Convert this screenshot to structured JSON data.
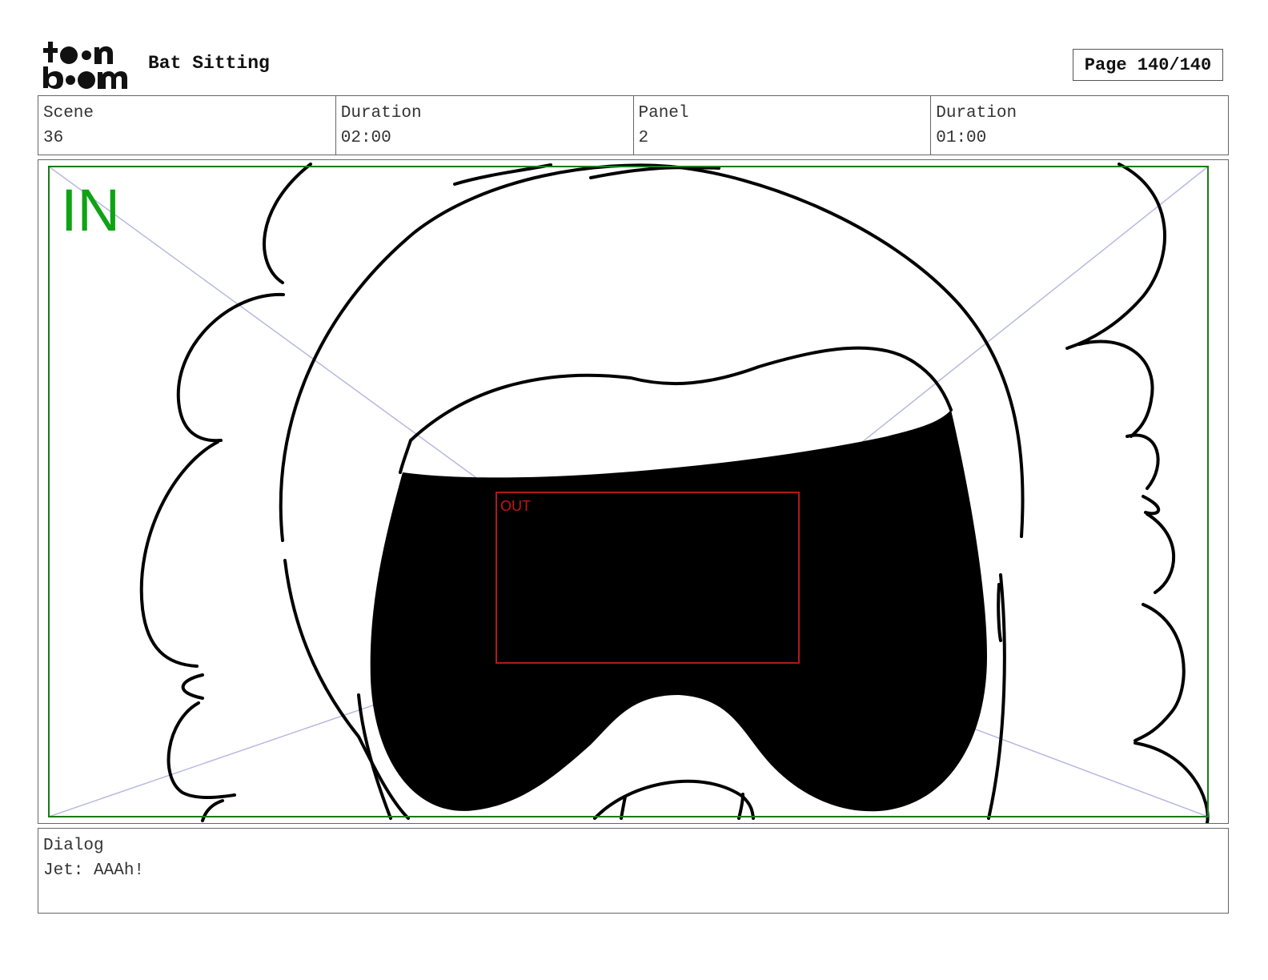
{
  "header": {
    "logo": {
      "line1": "toon",
      "line2": "boom"
    },
    "project_title": "Bat Sitting",
    "page_label": "Page 140/140"
  },
  "info": {
    "scene_label": "Scene",
    "scene_value": "36",
    "scene_duration_label": "Duration",
    "scene_duration_value": "02:00",
    "panel_label": "Panel",
    "panel_value": "2",
    "panel_duration_label": "Duration",
    "panel_duration_value": "01:00"
  },
  "panel": {
    "in_label": "IN",
    "out_label": "OUT",
    "colors": {
      "in_frame": "#1a7a1a",
      "in_text": "#0fa314",
      "out_frame": "#b01a1a",
      "guides": "#b8b8e0"
    }
  },
  "dialog": {
    "label": "Dialog",
    "text": "Jet: AAAh!"
  }
}
